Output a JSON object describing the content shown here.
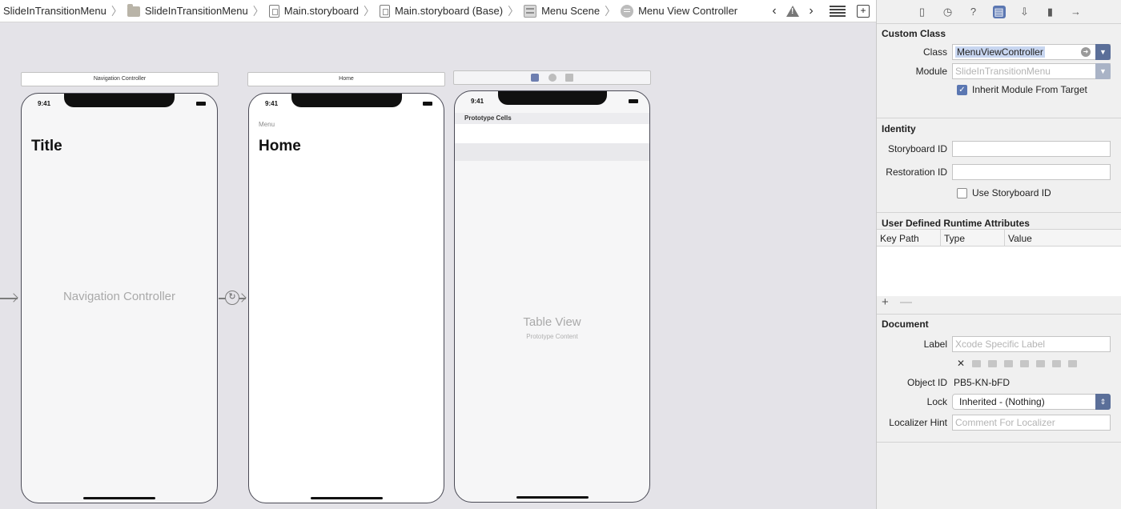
{
  "breadcrumb": [
    {
      "label": "SlideInTransitionMenu",
      "icon": "project-icon"
    },
    {
      "label": "SlideInTransitionMenu",
      "icon": "folder-icon"
    },
    {
      "label": "Main.storyboard",
      "icon": "storyboard-file-icon"
    },
    {
      "label": "Main.storyboard (Base)",
      "icon": "storyboard-file-icon"
    },
    {
      "label": "Menu Scene",
      "icon": "scene-icon"
    },
    {
      "label": "Menu View Controller",
      "icon": "view-controller-icon"
    }
  ],
  "canvas": {
    "nav_scene": {
      "bar_title": "Navigation Controller",
      "time": "9:41",
      "large_title": "Title",
      "placeholder": "Navigation Controller"
    },
    "home_scene": {
      "bar_title": "Home",
      "time": "9:41",
      "nav_small": "Menu",
      "large_title": "Home"
    },
    "menu_scene": {
      "time": "9:41",
      "section_header": "Prototype Cells",
      "placeholder": "Table View",
      "placeholder_sub": "Prototype Content"
    }
  },
  "inspector": {
    "custom_class": {
      "title": "Custom Class",
      "class_label": "Class",
      "class_value": "MenuViewController",
      "module_label": "Module",
      "module_placeholder": "SlideInTransitionMenu",
      "inherit_label": "Inherit Module From Target",
      "inherit_checked": true
    },
    "identity": {
      "title": "Identity",
      "storyboard_id_label": "Storyboard ID",
      "storyboard_id_value": "",
      "restoration_id_label": "Restoration ID",
      "restoration_id_value": "",
      "use_storyboard_id_label": "Use Storyboard ID",
      "use_storyboard_id_checked": false
    },
    "runtime_attrs": {
      "title": "User Defined Runtime Attributes",
      "columns": [
        "Key Path",
        "Type",
        "Value"
      ],
      "add": "+",
      "remove": "—"
    },
    "document": {
      "title": "Document",
      "label_label": "Label",
      "label_placeholder": "Xcode Specific Label",
      "clear_glyph": "✕",
      "object_id_label": "Object ID",
      "object_id_value": "PB5-KN-bFD",
      "lock_label": "Lock",
      "lock_value": "Inherited - (Nothing)",
      "localizer_hint_label": "Localizer Hint",
      "localizer_hint_placeholder": "Comment For Localizer"
    }
  },
  "colors": {
    "accent": "#5b77b2",
    "canvas_bg": "#e4e3e8",
    "inspector_bg": "#f0f0f0"
  }
}
